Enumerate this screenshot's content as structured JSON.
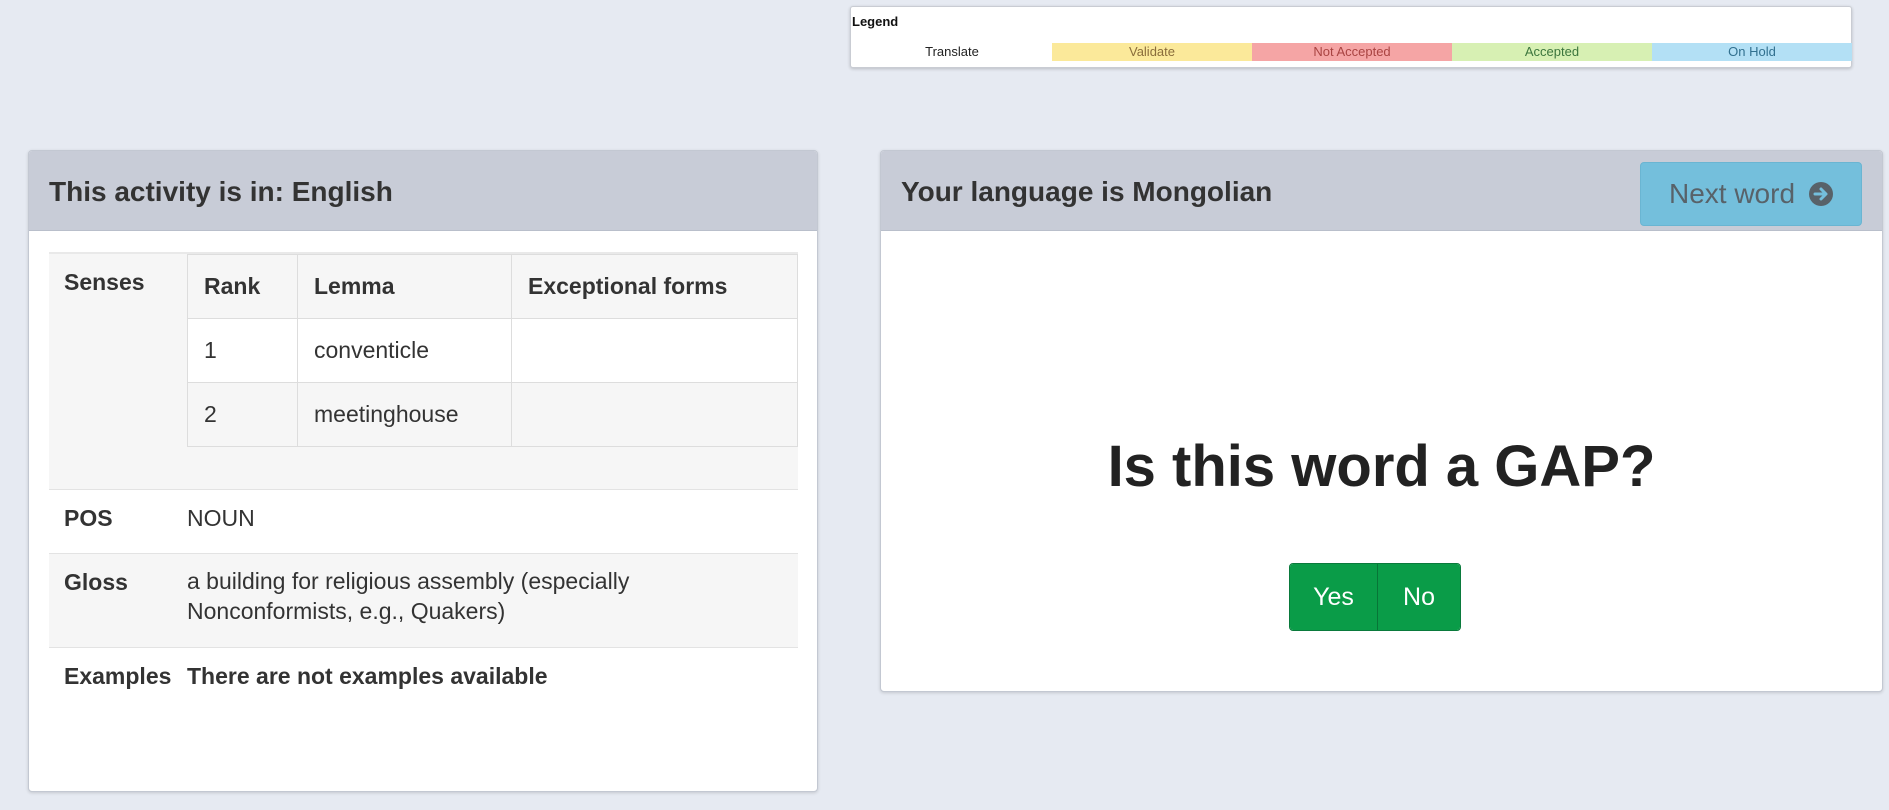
{
  "legend": {
    "title": "Legend",
    "items": [
      {
        "label": "Translate",
        "color": "#ffffff"
      },
      {
        "label": "Validate",
        "color": "#fbe99a"
      },
      {
        "label": "Not Accepted",
        "color": "#f5a5a5"
      },
      {
        "label": "Accepted",
        "color": "#d7f0b3"
      },
      {
        "label": "On Hold",
        "color": "#b3e0f5"
      }
    ]
  },
  "left_panel": {
    "title": "This activity is in: English",
    "senses": {
      "label": "Senses",
      "columns": [
        "Rank",
        "Lemma",
        "Exceptional forms"
      ],
      "rows": [
        {
          "rank": "1",
          "lemma": "conventicle",
          "exceptional": ""
        },
        {
          "rank": "2",
          "lemma": "meetinghouse",
          "exceptional": ""
        }
      ]
    },
    "pos": {
      "label": "POS",
      "value": "NOUN"
    },
    "gloss": {
      "label": "Gloss",
      "value": "a building for religious assembly (especially Nonconformists, e.g., Quakers)"
    },
    "examples": {
      "label": "Examples",
      "value": "There are not examples available"
    }
  },
  "right_panel": {
    "title": "Your language is Mongolian",
    "next_button": "Next word",
    "question": "Is this word a GAP?",
    "yes_label": "Yes",
    "no_label": "No"
  },
  "colors": {
    "background": "#e6eaf2",
    "panel_heading": "#c8ccd7",
    "next_button": "#74bfdc",
    "answer_button": "#0a9c48"
  }
}
